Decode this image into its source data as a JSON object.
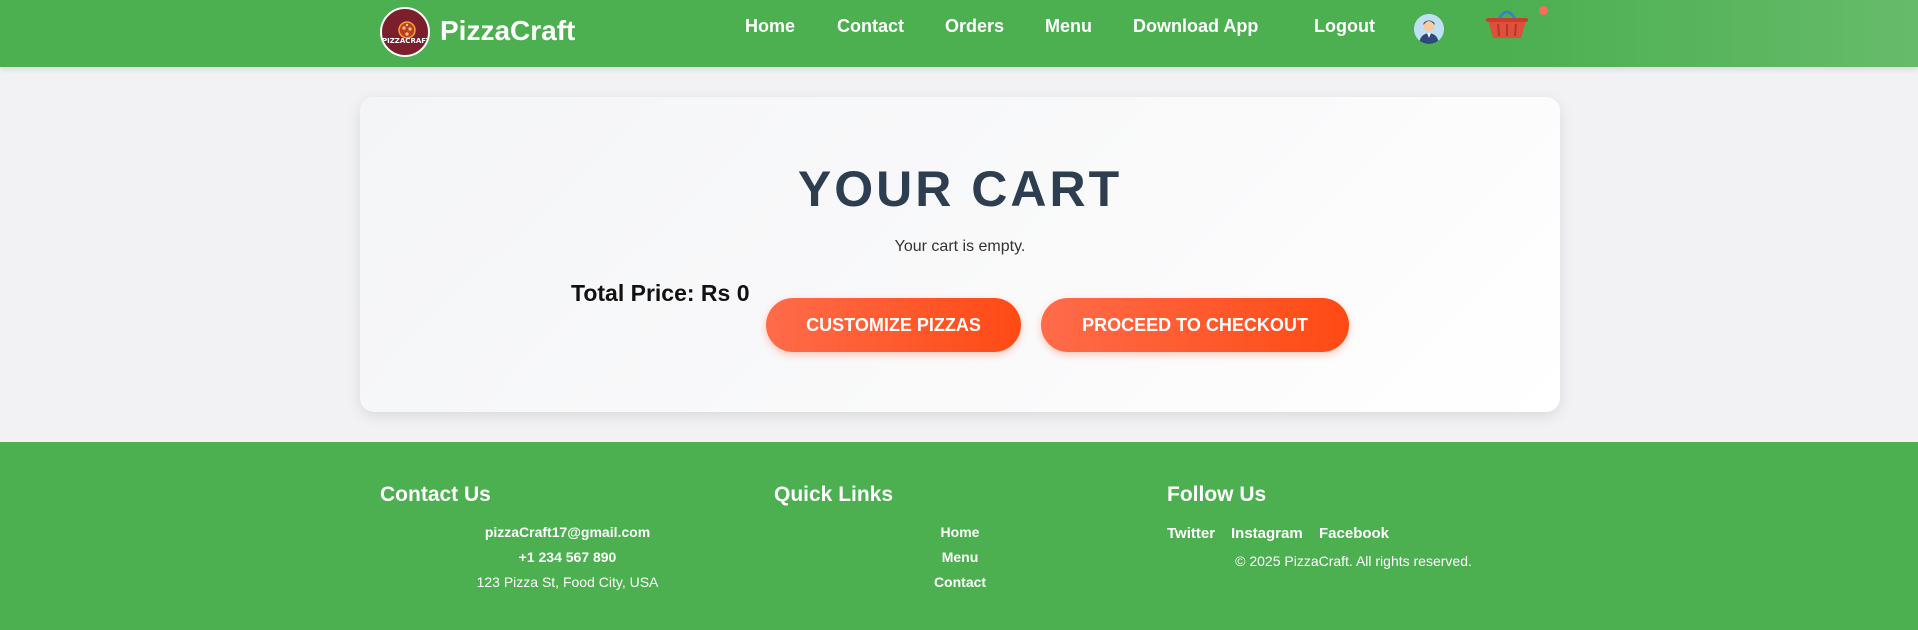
{
  "header": {
    "brand": "PizzaCraft",
    "logo_text": "PIZZACRAFT",
    "nav": [
      "Home",
      "Contact",
      "Orders",
      "Menu",
      "Download App",
      "Logout"
    ],
    "icons": {
      "profile": "user-avatar-icon",
      "cart": "shopping-basket-icon"
    },
    "cart_badge_color": "#ff6b5a"
  },
  "cart": {
    "title": "YOUR CART",
    "empty_message": "Your cart is empty.",
    "total_price": "Total Price: Rs 0",
    "customize_label": "CUSTOMIZE PIZZAS",
    "checkout_label": "PROCEED TO CHECKOUT"
  },
  "footer": {
    "contact": {
      "heading": "Contact Us",
      "email": "pizzaCraft17@gmail.com",
      "phone": "+1 234 567 890",
      "address": "123 Pizza St, Food City, USA"
    },
    "quick_links": {
      "heading": "Quick Links",
      "items": [
        "Home",
        "Menu",
        "Contact"
      ]
    },
    "follow": {
      "heading": "Follow Us",
      "items": [
        "Twitter",
        "Instagram",
        "Facebook"
      ]
    },
    "copyright": "© 2025 PizzaCraft. All rights reserved."
  },
  "colors": {
    "primary_green": "#4caf50",
    "accent_orange": "#ff5722",
    "title_navy": "#2c3e50"
  }
}
